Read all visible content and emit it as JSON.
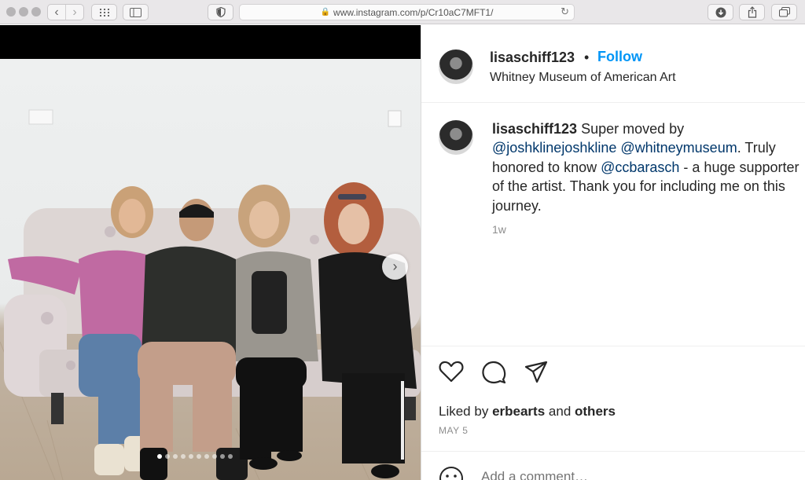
{
  "browser": {
    "url": "www.instagram.com/p/Cr10aC7MFT1/"
  },
  "post": {
    "username": "lisaschiff123",
    "bullet": "•",
    "follow_label": "Follow",
    "location": "Whitney Museum of American Art",
    "caption": {
      "username": "lisaschiff123",
      "text_1": "Super moved by",
      "mention_1": "@joshklinejoshkline",
      "mention_2": "@whitneymuseum",
      "text_2": ". Truly honored to know",
      "mention_3": "@ccbarasch",
      "text_3": " - a huge supporter of the artist. Thank you for including me on this journey."
    },
    "caption_time": "1w",
    "liked_by_prefix": "Liked by",
    "liked_by_user": "erbearts",
    "liked_by_and": "and",
    "liked_by_others": "others",
    "date": "MAY 5",
    "comment_placeholder": "Add a comment…",
    "carousel": {
      "total": 10,
      "active_index": 0
    }
  },
  "colors": {
    "follow": "#0095f6",
    "mention": "#00376b",
    "muted": "#8e8e8e"
  }
}
